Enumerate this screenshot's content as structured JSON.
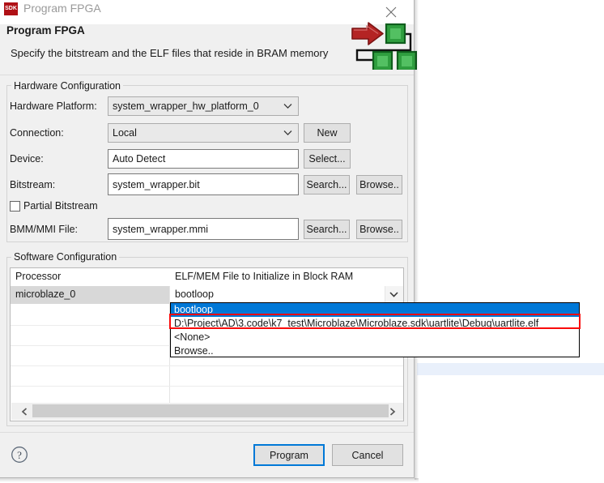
{
  "window": {
    "app_icon": "sdk-icon",
    "app_icon_text": "SDK",
    "title": "Program FPGA",
    "close_icon": "close-icon"
  },
  "header": {
    "title": "Program FPGA",
    "subtitle": "Specify the bitstream and the ELF files that reside in BRAM memory",
    "artwork": "fpga-block-diagram-icon"
  },
  "hardware_configuration": {
    "group_title": "Hardware Configuration",
    "hardware_platform": {
      "label": "Hardware Platform:",
      "value": "system_wrapper_hw_platform_0"
    },
    "connection": {
      "label": "Connection:",
      "value": "Local",
      "new_button": "New"
    },
    "device": {
      "label": "Device:",
      "value": "Auto Detect",
      "select_button": "Select..."
    },
    "bitstream": {
      "label": "Bitstream:",
      "value": "system_wrapper.bit",
      "search_button": "Search...",
      "browse_button": "Browse.."
    },
    "partial_bitstream": {
      "label": "Partial Bitstream",
      "checked": false
    },
    "bmm_mmi": {
      "label": "BMM/MMI File:",
      "value": "system_wrapper.mmi",
      "search_button": "Search...",
      "browse_button": "Browse.."
    }
  },
  "software_configuration": {
    "group_title": "Software Configuration",
    "table": {
      "columns": [
        "Processor",
        "ELF/MEM File to Initialize in Block RAM"
      ],
      "rows": [
        {
          "processor": "microblaze_0",
          "elf_file": "bootloop"
        }
      ],
      "empty_rows": 4,
      "scrollbar": {
        "left_arrow": "chevron-left-icon",
        "right_arrow": "chevron-right-icon"
      }
    },
    "dropdown": {
      "open": true,
      "selected_index": 0,
      "highlight_color": "#0078d7",
      "annotation_color": "#fa0b0b",
      "annotated_index": 1,
      "options": [
        "bootloop",
        "D:\\Project\\AD\\3.code\\k7_test\\Microblaze\\Microblaze.sdk\\uartlite\\Debug\\uartlite.elf",
        "<None>",
        "Browse.."
      ]
    }
  },
  "footer": {
    "help_icon": "help-question-icon",
    "program_button": "Program",
    "cancel_button": "Cancel",
    "primary_color": "#0078d7"
  }
}
